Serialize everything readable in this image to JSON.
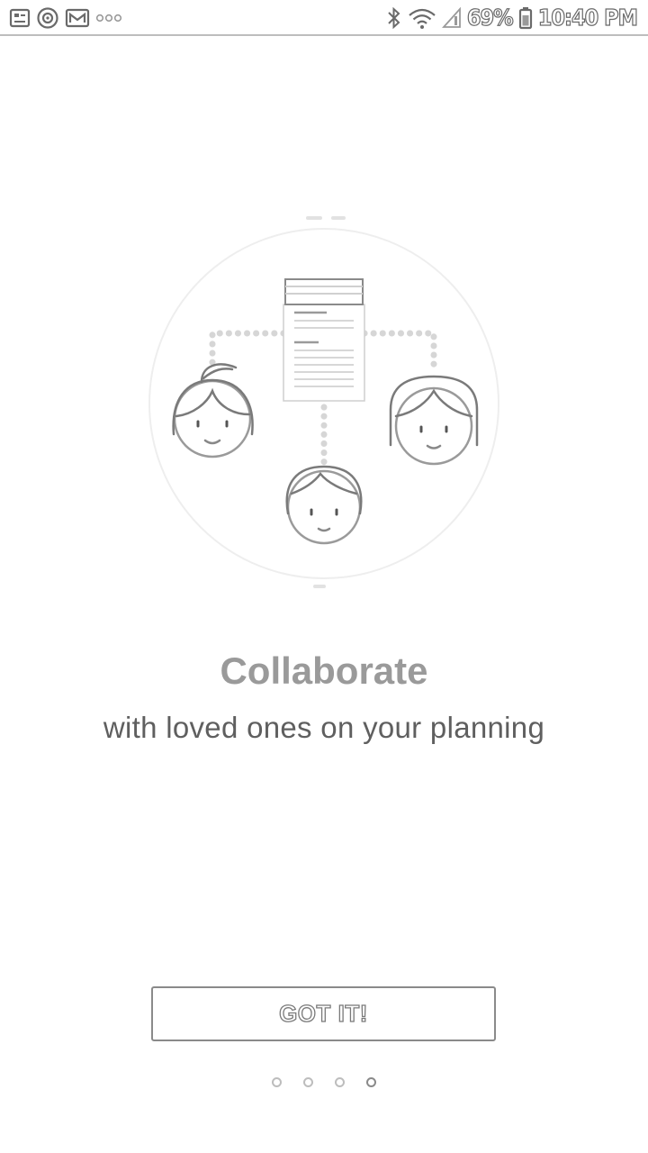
{
  "status_bar": {
    "left_icons": [
      "image-notification-icon",
      "target-notification-icon",
      "mail-notification-icon",
      "more-notifications-icon"
    ],
    "right_icons": [
      "bluetooth-icon",
      "wifi-icon",
      "signal-icon",
      "battery-icon"
    ],
    "battery": "69%",
    "time": "10:40 PM"
  },
  "onboarding": {
    "illustration": "collaboration-illustration",
    "title": "Collaborate",
    "subtitle": "with loved ones on your planning",
    "button_label": "GOT IT!",
    "page_count": 4,
    "current_page": 4
  },
  "colors": {
    "background": "#ffffff",
    "title": "#9a9a9a",
    "subtitle": "#5f5f5f",
    "button_border": "#8a8a8a",
    "dot_inactive": "#bdbdbd",
    "dot_active": "#8a8a8a"
  }
}
